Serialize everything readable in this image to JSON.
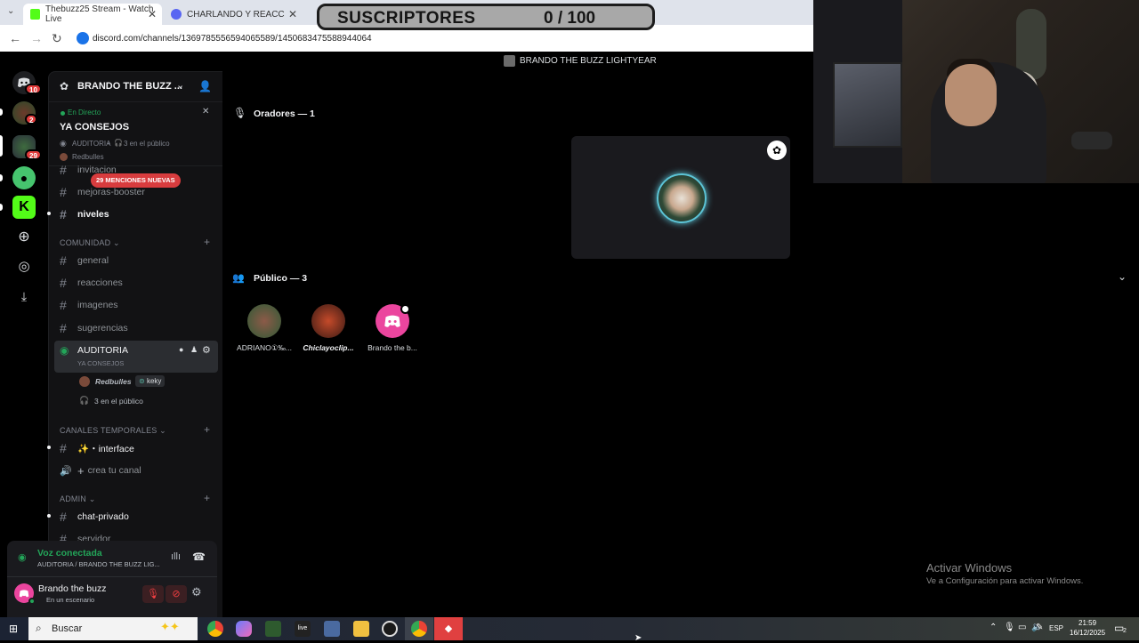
{
  "browser": {
    "tabs": [
      {
        "label": "Thebuzz25 Stream - Watch Live",
        "color": "#53fc18"
      },
      {
        "label": "CHARLANDO Y REACCIONAND",
        "color": "#5865f2"
      },
      {
        "label": "",
        "color": "#ff0000"
      }
    ],
    "url": "discord.com/channels/1369785556594065589/1450683475588944064"
  },
  "overlay": {
    "label": "SUSCRIPTORES",
    "count": "0 / 100"
  },
  "rail": {
    "badges": [
      "10",
      "2",
      "29"
    ]
  },
  "server": {
    "name": "BRANDO THE BUZZ ...",
    "live": {
      "status": "En Directo",
      "title": "YA CONSEJOS",
      "meta_channel": "AUDITORIA",
      "meta_audience": "3 en el público",
      "host": "Redbulles"
    },
    "mentions_badge": "29 MENCIONES NUEVAS",
    "channels_top": [
      {
        "name": "invitacion",
        "bright": false
      },
      {
        "name": "mejoras-booster",
        "bright": false
      },
      {
        "name": "niveles",
        "bright": true
      }
    ],
    "categories": {
      "comunidad": "COMUNIDAD",
      "temporales": "CANALES TEMPORALES",
      "admin": "ADMIN"
    },
    "comunidad_channels": [
      "general",
      "reacciones",
      "imagenes",
      "sugerencias"
    ],
    "stage": {
      "name": "AUDITORIA",
      "topic": "YA CONSEJOS",
      "speaker_1": "Redbulles",
      "speaker_2": "keky",
      "audience": "3 en el público"
    },
    "temp_channels": [
      "✨・interface",
      "crea tu canal"
    ],
    "admin_channels": [
      "chat-privado",
      "servidor"
    ]
  },
  "voice": {
    "status": "Voz conectada",
    "path": "AUDITORIA / BRANDO THE BUZZ LIG..."
  },
  "user": {
    "name": "Brando the buzz",
    "status": "En un escenario"
  },
  "stage_view": {
    "title": "BRANDO THE BUZZ LIGHTYEAR",
    "speakers_heading": "Oradores — 1",
    "audience_heading": "Público — 3",
    "audience": [
      {
        "name": "ADRIANO①‰..."
      },
      {
        "name": "Chiclayoclip..."
      },
      {
        "name": "Brando the b..."
      }
    ]
  },
  "windows_notice": {
    "title": "Activar Windows",
    "body": "Ve a Configuración para activar Windows."
  },
  "taskbar": {
    "search": "Buscar",
    "lang": "ESP",
    "time": "21:59",
    "date": "16/12/2025",
    "notif": "2"
  }
}
